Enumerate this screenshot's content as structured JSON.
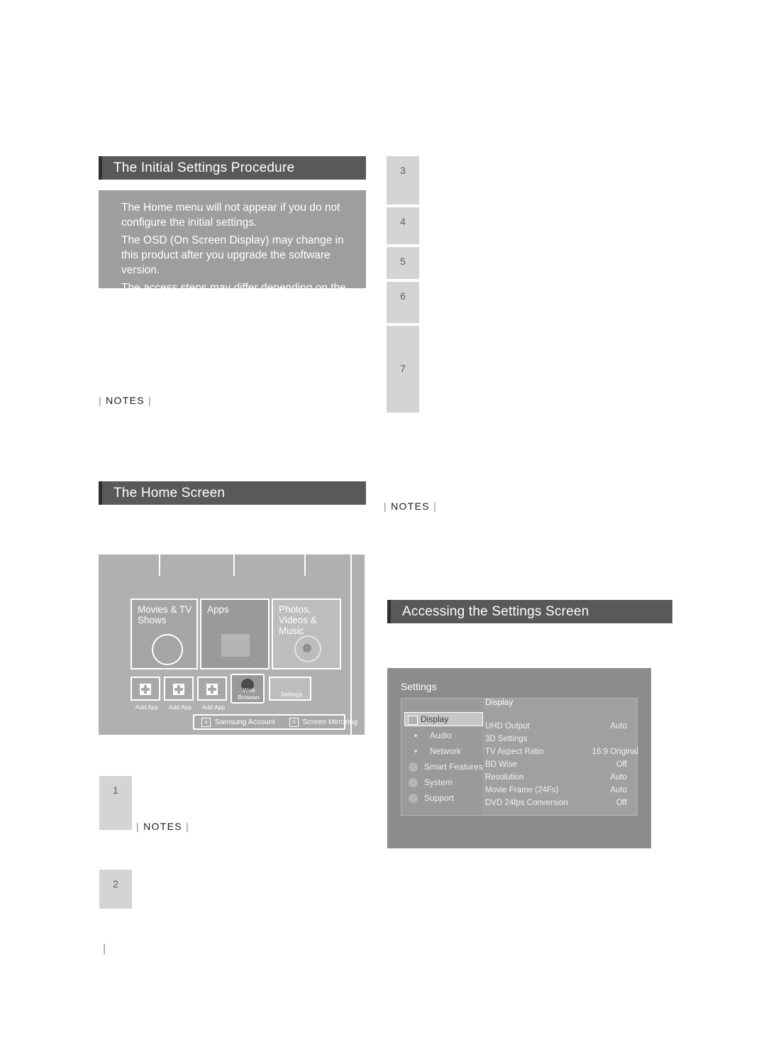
{
  "sections": {
    "initial_settings": {
      "heading": "The Initial Settings Procedure",
      "notes": [
        "The Home menu will not appear if you do not configure the initial settings.",
        "The OSD (On Screen Display) may change in this product after you upgrade the software version.",
        "The access steps may differ depending on the menu you selected."
      ],
      "notes_label": "NOTES",
      "steps": [
        "3",
        "4",
        "5",
        "6",
        "7"
      ]
    },
    "home_screen": {
      "heading": "The Home Screen",
      "notes_label": "NOTES",
      "right_notes_label": "NOTES",
      "steps": [
        "1",
        "2"
      ],
      "tiles": [
        {
          "label": "Movies & TV Shows"
        },
        {
          "label": "Apps"
        },
        {
          "label": "Photos, Videos & Music"
        }
      ],
      "app_buttons": [
        "Add App",
        "Add App",
        "Add App",
        "Web Browser",
        "Settings"
      ],
      "bottom_bar": [
        {
          "icon": "person-icon",
          "glyph": "a",
          "label": "Samsung Account"
        },
        {
          "icon": "cast-icon",
          "glyph": "d",
          "label": "Screen Mirroring"
        }
      ]
    },
    "accessing_settings": {
      "heading": "Accessing the Settings Screen",
      "screen": {
        "title": "Settings",
        "menu": [
          {
            "label": "Display",
            "selected": true,
            "icon": "display-icon"
          },
          {
            "label": "Audio",
            "selected": false,
            "icon": "audio-icon"
          },
          {
            "label": "Network",
            "selected": false,
            "icon": "network-icon"
          },
          {
            "label": "Smart Features",
            "selected": false,
            "icon": "smart-features-icon"
          },
          {
            "label": "System",
            "selected": false,
            "icon": "system-icon"
          },
          {
            "label": "Support",
            "selected": false,
            "icon": "support-icon"
          }
        ],
        "panel_title": "Display",
        "rows": [
          {
            "key": "UHD Output",
            "value": "Auto"
          },
          {
            "key": "3D Settings",
            "value": ""
          },
          {
            "key": "TV Aspect Ratio",
            "value": "16:9 Original"
          },
          {
            "key": "BD Wise",
            "value": "Off"
          },
          {
            "key": "Resolution",
            "value": "Auto"
          },
          {
            "key": "Movie Frame (24Fs)",
            "value": "Auto"
          },
          {
            "key": "DVD 24fps Conversion",
            "value": "Off"
          }
        ]
      }
    }
  },
  "footer": {
    "tick": "|"
  }
}
